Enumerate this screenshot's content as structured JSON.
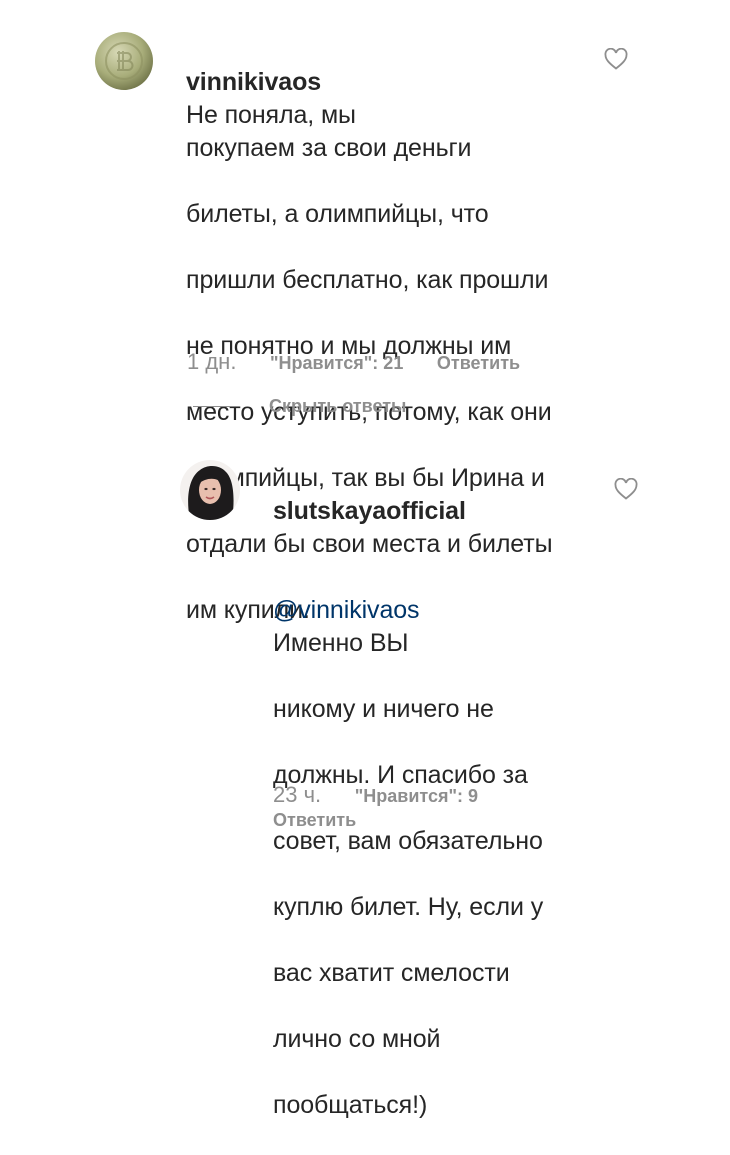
{
  "comments": [
    {
      "username": "vinnikivaos",
      "text": "Не поняла, мы",
      "lines": [
        "покупаем за свои деньги",
        "билеты, а олимпийцы, что",
        "пришли бесплатно, как прошли",
        "не понятно и мы должны им",
        "место уступить, потому, как они",
        "олимпийцы, так вы бы Ирина и",
        "отдали бы свои места и билеты",
        "им купили."
      ],
      "time": "1 дн.",
      "likes": "\"Нравится\": 21",
      "reply": "Ответить",
      "avatar_icon": "bitcoin-avatar-icon"
    },
    {
      "username": "slutskayaofficial",
      "mention": "@vinnikivaos",
      "text": "Именно ВЫ",
      "lines": [
        "никому и ничего не",
        "должны. И спасибо за",
        "совет, вам обязательно",
        "куплю билет. Ну, если у",
        "вас хватит смелости",
        "лично со мной",
        "пообщаться!)"
      ],
      "time": "23 ч.",
      "likes": "\"Нравится\": 9",
      "reply": "Ответить",
      "avatar_icon": "woman-portrait-avatar-icon"
    }
  ],
  "hide_replies": "Скрыть ответы",
  "colors": {
    "text": "#262626",
    "muted": "#8e8e8e",
    "mention": "#003569"
  }
}
